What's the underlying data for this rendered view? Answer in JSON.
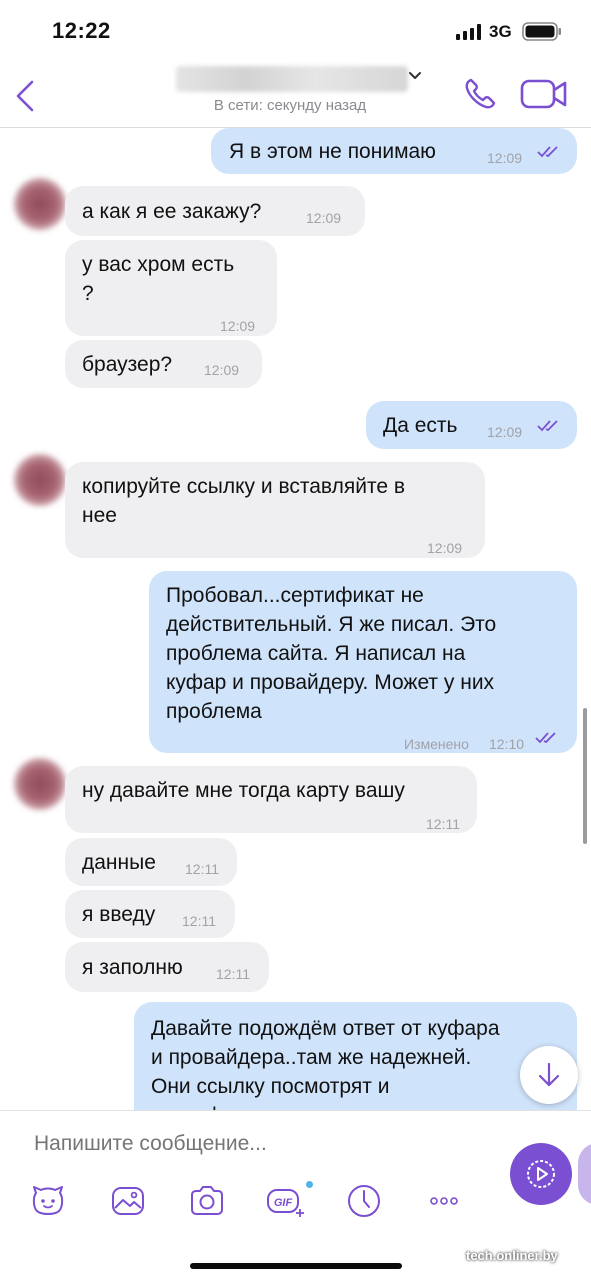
{
  "status_bar": {
    "time": "12:22",
    "network": "3G"
  },
  "header": {
    "presence": "В сети: секунду назад"
  },
  "messages": [
    {
      "dir": "out",
      "text": "Я в этом не понимаю",
      "time": "12:09"
    },
    {
      "dir": "in",
      "text": "а как я ее закажу?",
      "time": "12:09"
    },
    {
      "dir": "in",
      "text": "у вас хром есть\n?",
      "time": "12:09"
    },
    {
      "dir": "in",
      "text": "браузер?",
      "time": "12:09"
    },
    {
      "dir": "out",
      "text": "Да есть",
      "time": "12:09"
    },
    {
      "dir": "in",
      "text": "копируйте ссылку и вставляйте в\nнее",
      "time": "12:09"
    },
    {
      "dir": "out",
      "text": "Пробовал...сертификат не\nдействительный. Я же писал. Это\nпроблема сайта. Я написал на\nкуфар и провайдеру. Может у них\nпроблема",
      "time": "12:10",
      "edited": "Изменено"
    },
    {
      "dir": "in",
      "text": "ну давайте мне тогда карту вашу",
      "time": "12:11"
    },
    {
      "dir": "in",
      "text": "данные",
      "time": "12:11"
    },
    {
      "dir": "in",
      "text": "я введу",
      "time": "12:11"
    },
    {
      "dir": "in",
      "text": "я заполню",
      "time": "12:11"
    },
    {
      "dir": "out",
      "text": "Давайте подождём ответ от куфара\nи провайдера..там же надежней.\nОни ссылку посмотрят и\nсертификат проверят",
      "time": ""
    }
  ],
  "composer": {
    "placeholder": "Напишите сообщение...",
    "tools": [
      "sticker-icon",
      "gallery-icon",
      "camera-icon",
      "gif-icon",
      "timer-icon",
      "more-icon"
    ],
    "gif_label": "GIF"
  },
  "watermark": "tech.onliner.by",
  "colors": {
    "accent": "#7b4fd1",
    "outgoing": "#cfe3fb",
    "incoming": "#efeff1",
    "read_ticks": "#7b4fd1"
  }
}
